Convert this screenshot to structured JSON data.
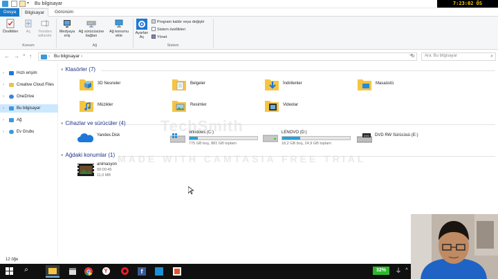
{
  "window": {
    "title": "Bu bilgisayar",
    "clock": "7:23:02 ÖS 01/04/2018"
  },
  "ribbon_tabs": [
    "Dosya",
    "Bilgisayar",
    "Görünüm"
  ],
  "ribbon": {
    "konum": {
      "group_label": "Konum",
      "buttons": [
        "Özellikler",
        "Aç",
        "Yeniden adlandır"
      ]
    },
    "ag": {
      "group_label": "Ağ",
      "buttons": [
        "Medyaya eriş",
        "Ağ sürücüsüne bağlan",
        "Ağ konumu ekle"
      ]
    },
    "sistem": {
      "group_label": "Sistem",
      "buttons": [
        "Ayarları Aç"
      ],
      "small_items": [
        "Program kaldır veya değiştir",
        "Sistem özellikleri",
        "Yönet"
      ]
    }
  },
  "address": {
    "path": "Bu bilgisayar",
    "search_placeholder": "Ara: Bu bilgisayar"
  },
  "nav_pane": [
    {
      "label": "Hızlı erişim",
      "chevron": "›",
      "color": "#1e78d6"
    },
    {
      "label": "Creative Cloud Files",
      "chevron": "›",
      "color": "#e8c25a"
    },
    {
      "label": "OneDrive",
      "chevron": "›",
      "color": "#3a86d4"
    },
    {
      "label": "Bu bilgisayar",
      "chevron": "›",
      "color": "#3a9ad9",
      "selected": true
    },
    {
      "label": "Ağ",
      "chevron": "›",
      "color": "#3a9ad9"
    },
    {
      "label": "Ev Grubu",
      "chevron": "›",
      "color": "#3a9ad9"
    }
  ],
  "sections": {
    "folders_header": "Klasörler (7)",
    "devices_header": "Cihazlar ve sürücüler (4)",
    "network_header": "Ağdaki konumlar (1)"
  },
  "folders": [
    {
      "label": "3D Nesneler"
    },
    {
      "label": "Belgeler"
    },
    {
      "label": "İndirilenler"
    },
    {
      "label": "Masaüstü"
    },
    {
      "label": "Müzikler"
    },
    {
      "label": "Resimler"
    },
    {
      "label": "Videolar"
    }
  ],
  "drives": [
    {
      "label": "Yandex.Disk",
      "has_bar": false
    },
    {
      "label": "Windows (C:)",
      "has_bar": true,
      "used_fraction": 0.12,
      "caption": "775 GB boş, 881 GB toplam"
    },
    {
      "label": "LENOVO (D:)",
      "has_bar": true,
      "used_fraction": 0.27,
      "caption": "18,2 GB boş, 24,9 GB toplam"
    },
    {
      "label": "DVD RW Sürücüsü (E:)",
      "has_bar": false
    }
  ],
  "network_items": [
    {
      "label": "animasyon",
      "line2": "00:00:45",
      "line3": "11,0 MB"
    }
  ],
  "watermark": {
    "line1": "TechSmith",
    "line2": "MADE WITH CAMTASIA FREE TRIAL"
  },
  "status": {
    "count": "12 öğe"
  },
  "taskbar": {
    "battery": "32%"
  }
}
